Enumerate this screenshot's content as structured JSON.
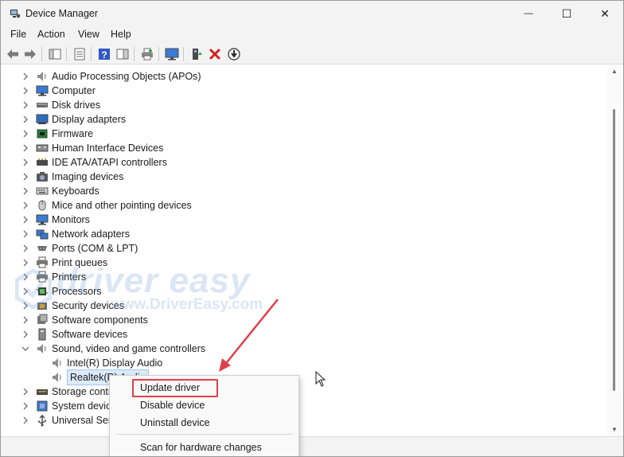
{
  "window": {
    "title": "Device Manager",
    "minimize": "—",
    "maximize": "☐",
    "close": "✕"
  },
  "menu": [
    "File",
    "Action",
    "View",
    "Help"
  ],
  "tree": [
    {
      "label": "Audio Processing Objects (APOs)",
      "icon": "speaker-icon",
      "expanded": false
    },
    {
      "label": "Computer",
      "icon": "computer-icon",
      "expanded": false
    },
    {
      "label": "Disk drives",
      "icon": "disk-drive-icon",
      "expanded": false
    },
    {
      "label": "Display adapters",
      "icon": "display-adapter-icon",
      "expanded": false
    },
    {
      "label": "Firmware",
      "icon": "firmware-icon",
      "expanded": false
    },
    {
      "label": "Human Interface Devices",
      "icon": "hid-icon",
      "expanded": false
    },
    {
      "label": "IDE ATA/ATAPI controllers",
      "icon": "ide-controller-icon",
      "expanded": false
    },
    {
      "label": "Imaging devices",
      "icon": "camera-icon",
      "expanded": false
    },
    {
      "label": "Keyboards",
      "icon": "keyboard-icon",
      "expanded": false
    },
    {
      "label": "Mice and other pointing devices",
      "icon": "mouse-icon",
      "expanded": false
    },
    {
      "label": "Monitors",
      "icon": "monitor-icon",
      "expanded": false
    },
    {
      "label": "Network adapters",
      "icon": "network-adapter-icon",
      "expanded": false
    },
    {
      "label": "Ports (COM & LPT)",
      "icon": "port-icon",
      "expanded": false
    },
    {
      "label": "Print queues",
      "icon": "printer-icon",
      "expanded": false
    },
    {
      "label": "Printers",
      "icon": "printer-icon",
      "expanded": false
    },
    {
      "label": "Processors",
      "icon": "processor-icon",
      "expanded": false
    },
    {
      "label": "Security devices",
      "icon": "security-device-icon",
      "expanded": false
    },
    {
      "label": "Software components",
      "icon": "software-component-icon",
      "expanded": false
    },
    {
      "label": "Software devices",
      "icon": "software-device-icon",
      "expanded": false
    },
    {
      "label": "Sound, video and game controllers",
      "icon": "speaker-icon",
      "expanded": true
    }
  ],
  "sound_children": [
    {
      "label": "Intel(R) Display Audio",
      "icon": "speaker-icon"
    },
    {
      "label": "Realtek(R) Audio",
      "icon": "speaker-icon",
      "selected": true
    }
  ],
  "tree_after": [
    {
      "label": "Storage controllers",
      "icon": "storage-controller-icon"
    },
    {
      "label": "System devices",
      "icon": "system-device-icon"
    },
    {
      "label": "Universal Serial Bus controllers",
      "icon": "usb-icon"
    }
  ],
  "context_menu": {
    "update": "Update driver",
    "disable": "Disable device",
    "uninstall": "Uninstall device",
    "scan": "Scan for hardware changes"
  },
  "watermark": {
    "brand": "driver easy",
    "site": "www.DriverEasy.com"
  },
  "colors": {
    "chrome": "#f3f3f3",
    "selection": "#dcebfa",
    "annotation": "#e0404a",
    "delete_red": "#d21f1f"
  }
}
